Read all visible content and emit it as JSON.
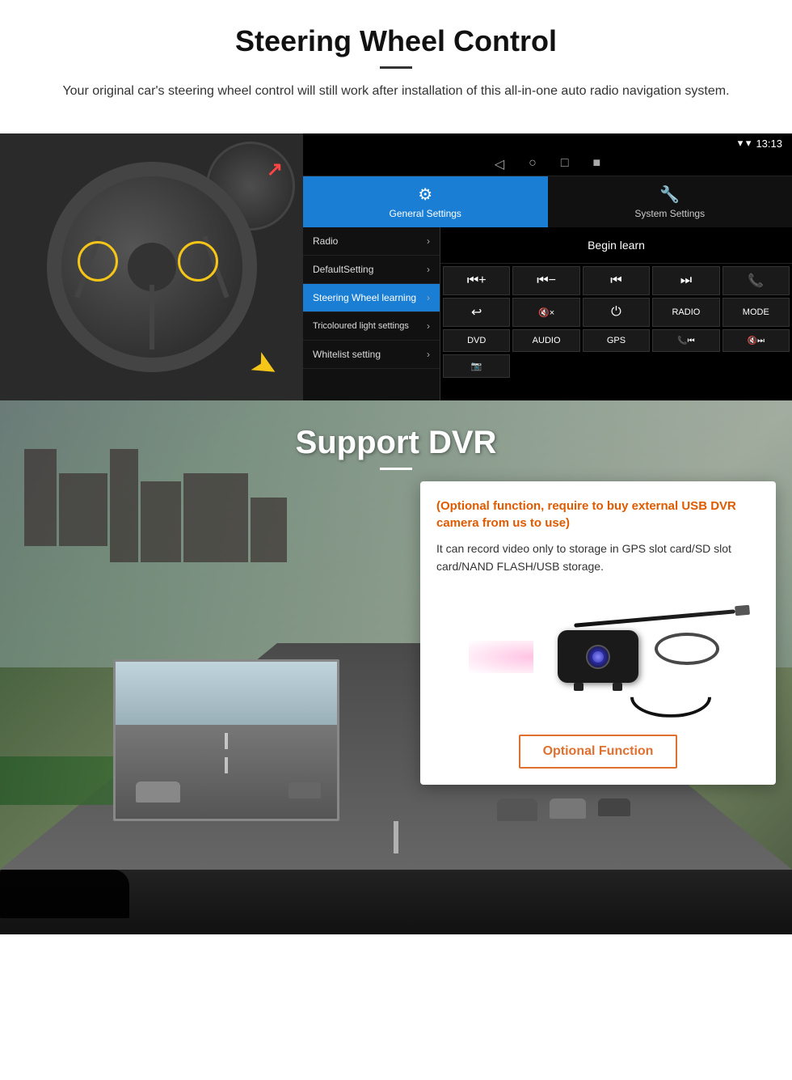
{
  "steering_section": {
    "title": "Steering Wheel Control",
    "description": "Your original car's steering wheel control will still work after installation of this all-in-one auto radio navigation system.",
    "android_ui": {
      "statusbar": {
        "time": "13:13",
        "icons": [
          "signal",
          "wifi",
          "battery"
        ]
      },
      "nav_icons": [
        "◁",
        "○",
        "□",
        "■"
      ],
      "tabs": [
        {
          "label": "General Settings",
          "active": true,
          "icon": "⚙"
        },
        {
          "label": "System Settings",
          "active": false,
          "icon": "🔧"
        }
      ],
      "menu_items": [
        {
          "label": "Radio",
          "active": false
        },
        {
          "label": "DefaultSetting",
          "active": false
        },
        {
          "label": "Steering Wheel learning",
          "active": true
        },
        {
          "label": "Tricoloured light settings",
          "active": false
        },
        {
          "label": "Whitelist setting",
          "active": false
        }
      ],
      "begin_learn_button": "Begin learn",
      "control_buttons": [
        "⏮+",
        "⏮−",
        "⏮⏮",
        "⏭⏭",
        "📞",
        "↩",
        "🔇×",
        "⏻",
        "RADIO",
        "MODE",
        "DVD",
        "AUDIO",
        "GPS",
        "📞⏮",
        "🔇⏭",
        "📷"
      ]
    }
  },
  "dvr_section": {
    "title": "Support DVR",
    "optional_note": "(Optional function, require to buy external USB DVR camera from us to use)",
    "description": "It can record video only to storage in GPS slot card/SD slot card/NAND FLASH/USB storage.",
    "optional_function_button": "Optional Function"
  }
}
